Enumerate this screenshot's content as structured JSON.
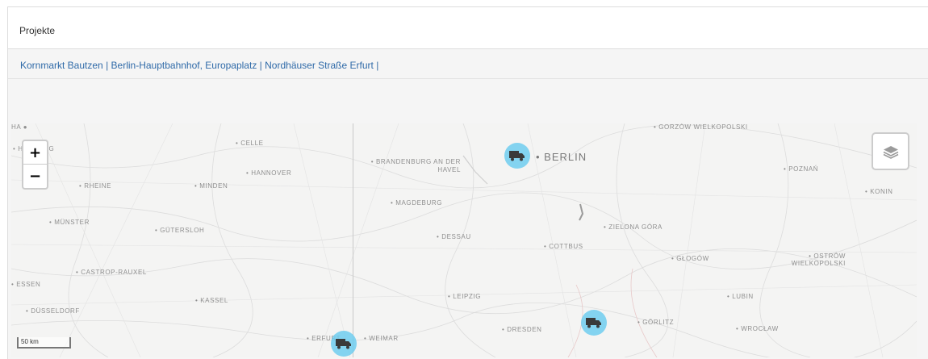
{
  "panel": {
    "title": "Projekte"
  },
  "projects": [
    {
      "label": "Kornmarkt Bautzen"
    },
    {
      "label": "Berlin-Hauptbahnhof, Europaplatz"
    },
    {
      "label": "Nordhäuser Straße Erfurt"
    }
  ],
  "separator": "|",
  "map": {
    "zoom_in": "+",
    "zoom_out": "−",
    "layers_icon": "layers-icon",
    "marker_icon": "truck-icon",
    "marker_color": "#6ecdee",
    "scale": "50 km",
    "cities": [
      "HAMBURG",
      "CELLE",
      "HANNOVER",
      "RHEINE",
      "MINDEN",
      "MÜNSTER",
      "GÜTERSLOH",
      "CASTROP-RAUXEL",
      "ESSEN",
      "DÜSSELDORF",
      "KASSEL",
      "BRANDENBURG AN DER HAVEL",
      "BERLIN",
      "MAGDEBURG",
      "DESSAU",
      "COTTBUS",
      "LEIPZIG",
      "DRESDEN",
      "ERFURT",
      "WEIMAR",
      "GORZÓW WIELKOPOLSKI",
      "POZNAŃ",
      "KONIN",
      "ZIELONA GÓRA",
      "GŁOGÓW",
      "OSTRÓW WIELKOPOLSKI",
      "LUBIN",
      "GÖRLITZ",
      "WROCŁAW"
    ]
  }
}
